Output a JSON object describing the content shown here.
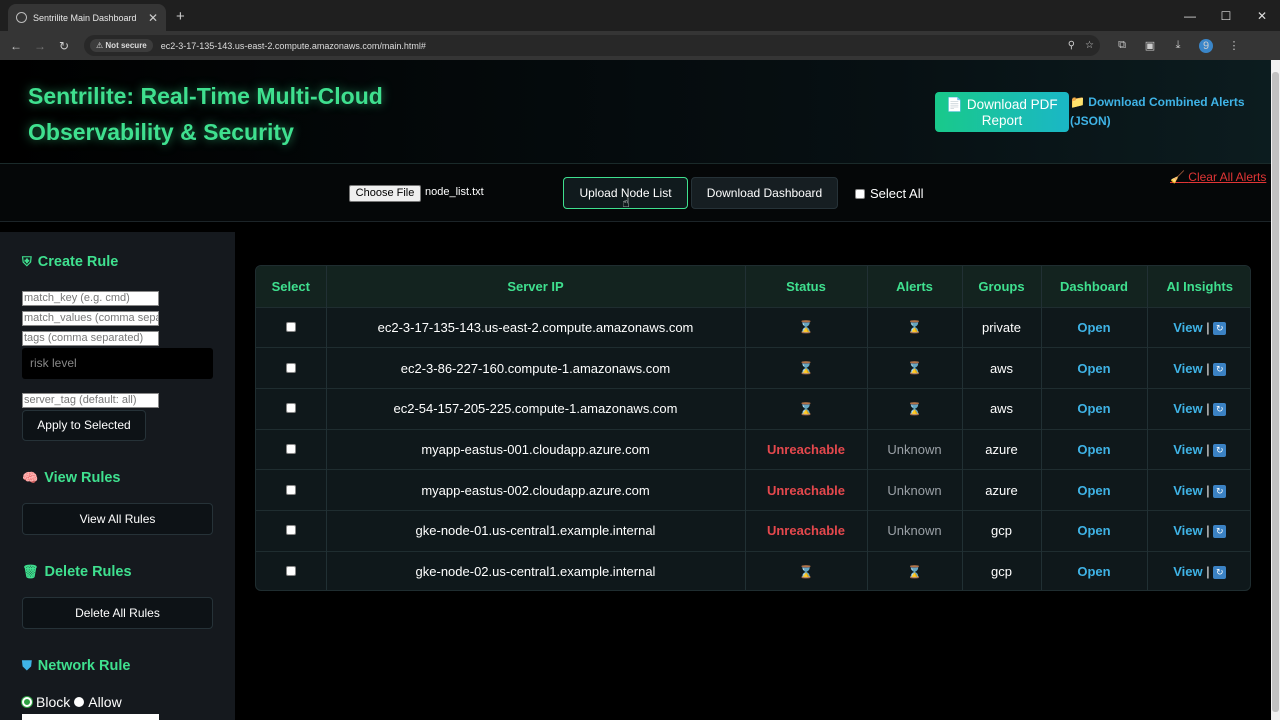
{
  "browser": {
    "tab_title": "Sentrilite Main Dashboard",
    "tab_close": "✕",
    "new_tab": "+",
    "url_badge": "Not secure",
    "url": "ec2-3-17-135-143.us-east-2.compute.amazonaws.com/main.html#",
    "profile_initial": "9"
  },
  "header": {
    "title": "Sentrilite: Real-Time Multi-Cloud Observability & Security",
    "pdf_button": "Download PDF Report",
    "combined_link": "Download Combined Alerts (JSON)"
  },
  "controls": {
    "choose_file": "Choose File",
    "file_name": "node_list.txt",
    "upload_button": "Upload Node List",
    "download_dashboard": "Download Dashboard",
    "select_all": "Select All",
    "clear_alerts": "Clear All Alerts"
  },
  "sidebar": {
    "create_rule": {
      "heading": "Create Rule",
      "match_key_placeholder": "match_key (e.g. cmd)",
      "match_values_placeholder": "match_values (comma separated)",
      "tags_placeholder": "tags (comma separated)",
      "risk_placeholder": "risk level",
      "server_tag_placeholder": "server_tag (default: all)",
      "apply_button": "Apply to Selected"
    },
    "view_rules": {
      "heading": "View Rules",
      "button": "View All Rules"
    },
    "delete_rules": {
      "heading": "Delete Rules",
      "button": "Delete All Rules"
    },
    "network_rule": {
      "heading": "Network Rule",
      "block": "Block",
      "allow": "Allow"
    }
  },
  "table": {
    "headers": [
      "Select",
      "Server IP",
      "Status",
      "Alerts",
      "Groups",
      "Dashboard",
      "AI Insights"
    ],
    "open_label": "Open",
    "view_label": "View",
    "separator": "|",
    "rows": [
      {
        "server": "ec2-3-17-135-143.us-east-2.compute.amazonaws.com",
        "status": "⌛",
        "alerts": "⌛",
        "group": "private"
      },
      {
        "server": "ec2-3-86-227-160.compute-1.amazonaws.com",
        "status": "⌛",
        "alerts": "⌛",
        "group": "aws"
      },
      {
        "server": "ec2-54-157-205-225.compute-1.amazonaws.com",
        "status": "⌛",
        "alerts": "⌛",
        "group": "aws"
      },
      {
        "server": "myapp-eastus-001.cloudapp.azure.com",
        "status": "Unreachable",
        "alerts": "Unknown",
        "group": "azure"
      },
      {
        "server": "myapp-eastus-002.cloudapp.azure.com",
        "status": "Unreachable",
        "alerts": "Unknown",
        "group": "azure"
      },
      {
        "server": "gke-node-01.us-central1.example.internal",
        "status": "Unreachable",
        "alerts": "Unknown",
        "group": "gcp"
      },
      {
        "server": "gke-node-02.us-central1.example.internal",
        "status": "⌛",
        "alerts": "⌛",
        "group": "gcp"
      }
    ]
  },
  "colors": {
    "accent_green": "#3fe08f",
    "link_blue": "#3fb3e6",
    "error_red": "#e5484d"
  }
}
